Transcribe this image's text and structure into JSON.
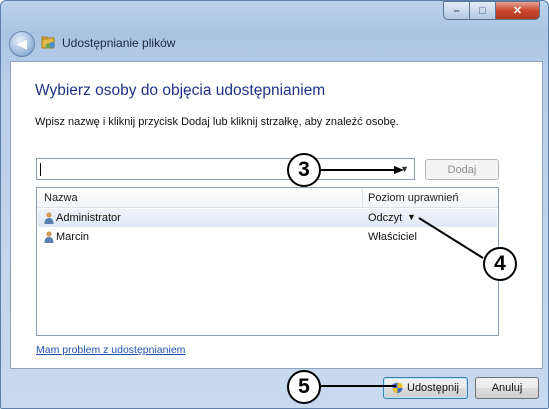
{
  "window": {
    "title": "Udostępnianie plików",
    "controls": [
      "minimize-icon",
      "maximize-icon",
      "close-icon"
    ]
  },
  "main": {
    "heading": "Wybierz osoby do objęcia udostępnianiem",
    "instruction": "Wpisz nazwę i kliknij przycisk Dodaj lub kliknij strzałkę, aby znaleźć osobę.",
    "combo_value": "",
    "add_button": "Dodaj",
    "columns": [
      "Nazwa",
      "Poziom uprawnień"
    ],
    "rows": [
      {
        "name": "Administrator",
        "permission": "Odczyt",
        "selected": true,
        "has_dropdown": true
      },
      {
        "name": "Marcin",
        "permission": "Właściciel",
        "selected": false,
        "has_dropdown": false
      }
    ],
    "help_link": "Mam problem z udostępnianiem"
  },
  "footer": {
    "share_button": "Udostępnij",
    "cancel_button": "Anuluj"
  },
  "callouts": [
    "3",
    "4",
    "5"
  ],
  "colors": {
    "heading": "#1e3287",
    "link": "#1f4fb2",
    "close_button": "#c8462c",
    "chrome": "#b9cfe8"
  }
}
